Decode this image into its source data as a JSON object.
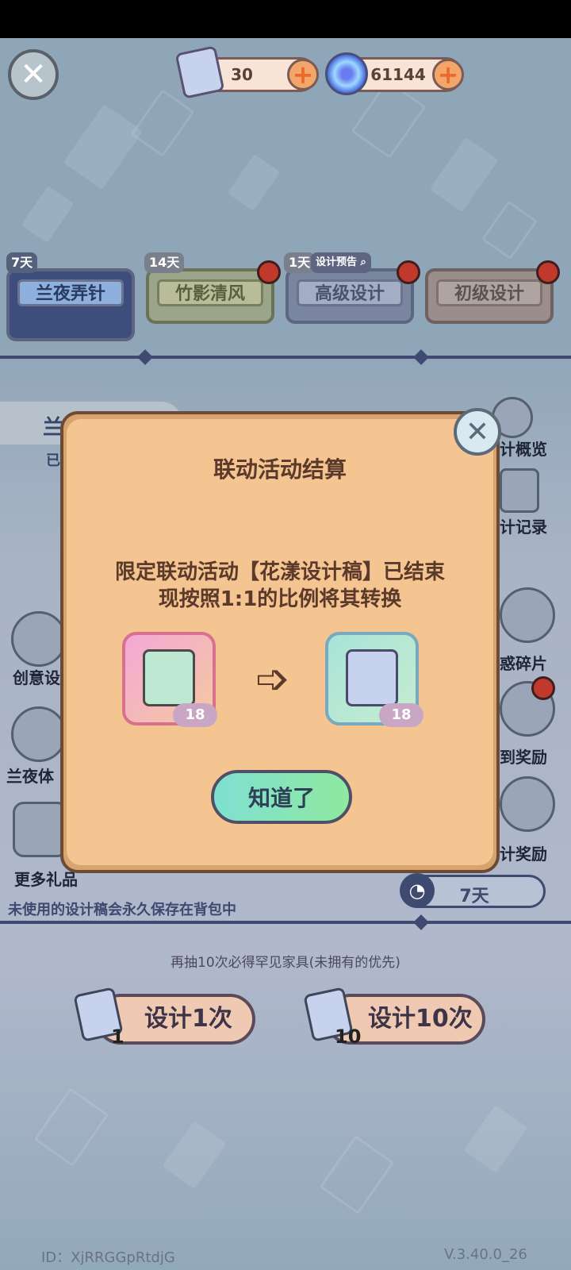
{
  "header": {
    "currency_design_scroll": "30",
    "currency_swirl": "61144"
  },
  "tabs": [
    {
      "days": "7天",
      "label": "兰夜弄针"
    },
    {
      "days": "14天",
      "label": "竹影清风"
    },
    {
      "days": "1天",
      "preview": "设计预告",
      "label": "高级设计"
    },
    {
      "label": "初级设计"
    }
  ],
  "side_left": [
    "创意设",
    "兰夜体",
    "更多礼品"
  ],
  "side_right": [
    "计概览",
    "计记录",
    "惑碎片",
    "到奖励",
    "计奖励"
  ],
  "left_partial": {
    "top": "兰",
    "bottom": "已"
  },
  "timer": {
    "label": "7天"
  },
  "storage_note": "未使用的设计稿会永久保存在背包中",
  "dialog": {
    "title": "联动活动结算",
    "message_line1": "限定联动活动【花漾设计稿】已结束",
    "message_line2": "现按照1:1的比例将其转换",
    "from_count": "18",
    "to_count": "18",
    "ok_label": "知道了"
  },
  "bottom": {
    "note": "再抽10次必得罕见家具(未拥有的优先)",
    "design_once_label": "设计1次",
    "design_once_count": "1",
    "design_ten_label": "设计10次",
    "design_ten_count": "10"
  },
  "footer": {
    "id": "ID：XjRRGGpRtdjG",
    "version": "V.3.40.0_26"
  },
  "colors": {
    "dialog_bg": "#f4c590",
    "ok_button": "#8fe9a0",
    "red_dot": "#c0392b"
  }
}
